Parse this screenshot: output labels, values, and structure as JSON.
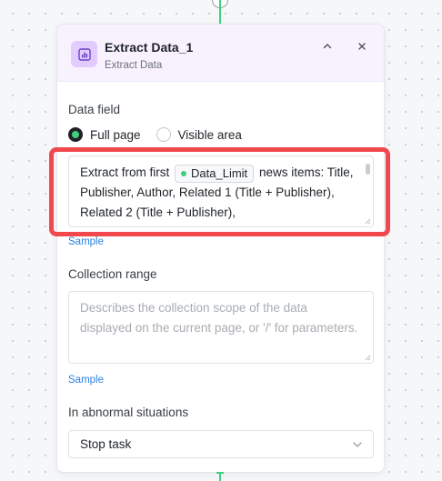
{
  "node": {
    "title": "Extract Data_1",
    "subtitle": "Extract Data",
    "icon": "chart-icon"
  },
  "data_field": {
    "label": "Data field",
    "options": [
      {
        "label": "Full page",
        "checked": true
      },
      {
        "label": "Visible area",
        "checked": false
      }
    ],
    "content_prefix": "Extract from first",
    "token": "Data_Limit",
    "content_suffix": "news items: Title, Publisher, Author, Related 1 (Title + Publisher), Related 2 (Title + Publisher),",
    "sample_label": "Sample"
  },
  "collection_range": {
    "label": "Collection range",
    "placeholder": "Describes the collection scope of the data displayed on the current page, or '/' for parameters.",
    "sample_label": "Sample"
  },
  "abnormal": {
    "label": "In abnormal situations",
    "selected": "Stop task"
  },
  "colors": {
    "accent_green": "#3fcf7f",
    "highlight_red": "#f0484c",
    "header_bg": "#f8f2ff",
    "icon_bg": "#e2ccff",
    "link_blue": "#2f7fe0"
  }
}
